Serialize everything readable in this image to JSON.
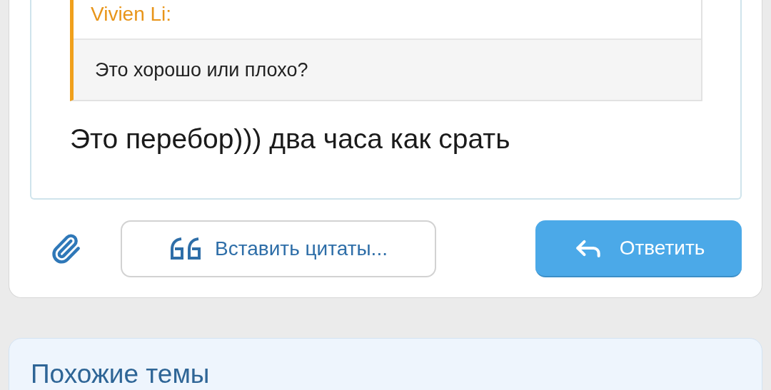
{
  "quote": {
    "author": "Vivien Li:",
    "text": "Это хорошо или плохо?"
  },
  "message": "Это перебор))) два часа как срать",
  "buttons": [
    {
      "kind": "insert_quotes",
      "label": "Вставить цитаты..."
    },
    {
      "kind": "reply",
      "label": "Ответить"
    }
  ],
  "similar": {
    "title": "Похожие темы"
  }
}
